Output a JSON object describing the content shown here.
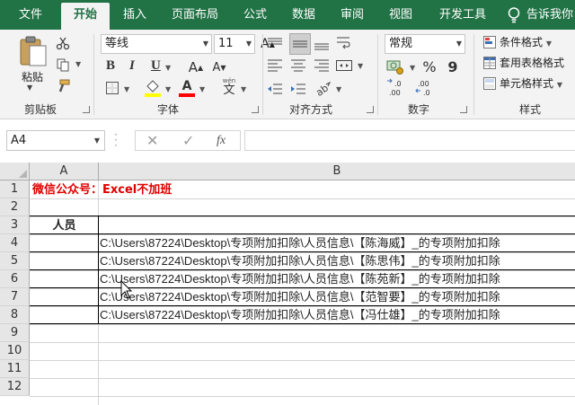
{
  "tabs": [
    "文件",
    "开始",
    "插入",
    "页面布局",
    "公式",
    "数据",
    "审阅",
    "视图",
    "开发工具"
  ],
  "tell_me": "告诉我你",
  "ribbon": {
    "paste_label": "粘贴",
    "clipboard_label": "剪贴板",
    "font_name": "等线",
    "font_size": "11",
    "bold": "B",
    "italic": "I",
    "underline": "U",
    "font_label": "字体",
    "wen": "wén",
    "wen_char": "文",
    "align_label": "对齐方式",
    "number_format": "常规",
    "percent": "%",
    "comma": "9",
    "number_label": "数字",
    "cond_format": "条件格式",
    "table_format": "套用表格格式",
    "cell_style": "单元格样式",
    "styles_label": "样式"
  },
  "formula_bar": {
    "name_box": "A4",
    "cancel": "✕",
    "confirm": "✓",
    "fx": "fx",
    "content": ""
  },
  "grid": {
    "columns": [
      "A",
      "B"
    ],
    "rows": [
      "1",
      "2",
      "3",
      "4",
      "5",
      "6",
      "7",
      "8",
      "9",
      "10",
      "11",
      "12"
    ],
    "title": "微信公众号：Excel不加班",
    "header": "人员",
    "paths": [
      "C:\\Users\\87224\\Desktop\\专项附加扣除\\人员信息\\【陈海威】_的专项附加扣除",
      "C:\\Users\\87224\\Desktop\\专项附加扣除\\人员信息\\【陈思伟】_的专项附加扣除",
      "C:\\Users\\87224\\Desktop\\专项附加扣除\\人员信息\\【陈苑新】_的专项附加扣除",
      "C:\\Users\\87224\\Desktop\\专项附加扣除\\人员信息\\【范智要】_的专项附加扣除",
      "C:\\Users\\87224\\Desktop\\专项附加扣除\\人员信息\\【冯仕雄】_的专项附加扣除"
    ]
  },
  "colors": {
    "ribbon_green": "#217346",
    "title_red": "#e00000",
    "highlight_yellow": "#ffff00",
    "font_red": "#ff0000"
  }
}
